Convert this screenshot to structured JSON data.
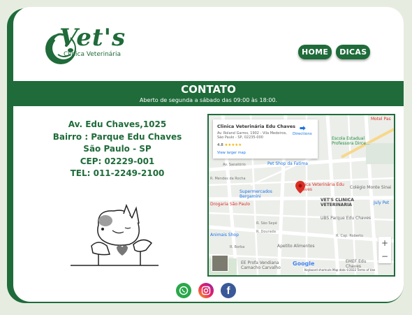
{
  "brand": {
    "title": "Vet's",
    "subtitle": "Clínica Veterinária"
  },
  "nav": {
    "home": "HOME",
    "dicas": "DICAS"
  },
  "banner": {
    "title": "CONTATO",
    "hours": "Aberto de segunda a sábado das 09:00 às 18:00."
  },
  "address": {
    "street": "Av. Edu Chaves,1025",
    "district": "Bairro : Parque Edu Chaves",
    "city": "São Paulo - SP",
    "cep": "CEP: 02229-001",
    "tel": "TEL: 011-2249-2100"
  },
  "map": {
    "place_name": "Clinica Veterinária Edu Chaves",
    "place_address": "Av. Roland Garros, 1902 - Vila Medeiros, São Paulo - SP, 02235-000",
    "rating": "4.8",
    "stars": "★★★★★",
    "directions": "Directions",
    "view_larger": "View larger map",
    "labels": {
      "motel": "Motel Pas",
      "escola": "Escola Estadual Professora Dirce...",
      "petshop": "Pet Shop da Fatima",
      "supermercados": "Supermercados Bergamini",
      "clinica": "Clinica Veterinária Edu Chaves",
      "colegio": "Colégio Monte Sinai",
      "vets": "VET'S CLINICA VETERINARIA",
      "july": "July Pet",
      "drogaria": "Drogaria São Paulo",
      "ubs": "UBS Parque Edu Chaves",
      "animais": "Animais Shop",
      "apetito": "Apetito Alimentos",
      "emef": "EMEF Edu Chaves",
      "ee": "EE Profa Vendiana Camacho Carvalho",
      "r_sao_sepe": "R. São Sepé",
      "r_dourada": "R. Dourada",
      "r_borba": "R. Borba",
      "r_cap_roberto": "R. Cap. Roberto",
      "av_sanatorio": "Av. Sanatório",
      "r_mendes": "R. Mendes da Rocha"
    },
    "zoom_in": "+",
    "zoom_out": "−",
    "google": "Google",
    "attribution": "Keyboard shortcuts   Map data ©2022   Terms of Use"
  },
  "social": {
    "whatsapp": "whatsapp-icon",
    "instagram": "instagram-icon",
    "facebook": "f"
  },
  "colors": {
    "brand_green": "#1f6b3a",
    "background": "#e6ede0"
  }
}
